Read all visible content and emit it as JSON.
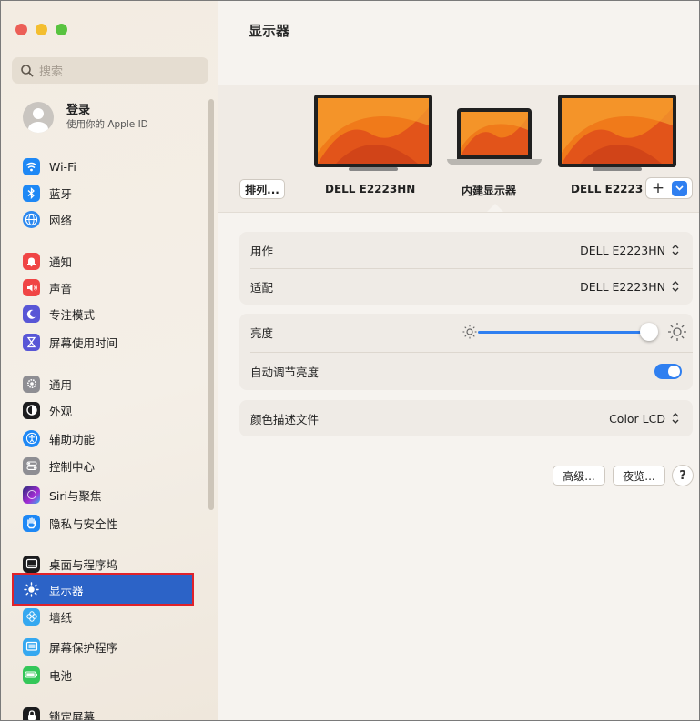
{
  "window": {
    "traffic_lights": {
      "close": "#ec5f57",
      "minimize": "#f3be2f",
      "zoom": "#58c33f"
    }
  },
  "sidebar": {
    "search": {
      "placeholder": "搜索",
      "icon": "search-icon"
    },
    "account": {
      "title": "登录",
      "subtitle": "使用你的 Apple ID"
    },
    "items": [
      {
        "label": "Wi-Fi",
        "icon": "wifi-icon",
        "color": "#1e88f5"
      },
      {
        "label": "蓝牙",
        "icon": "bluetooth-icon",
        "color": "#1e88f5"
      },
      {
        "label": "网络",
        "icon": "globe-icon",
        "color": "#2d89ef"
      },
      {
        "label": "通知",
        "icon": "bell-icon",
        "color": "#f04545"
      },
      {
        "label": "声音",
        "icon": "speaker-icon",
        "color": "#f04545"
      },
      {
        "label": "专注模式",
        "icon": "moon-icon",
        "color": "#5856d6"
      },
      {
        "label": "屏幕使用时间",
        "icon": "hourglass-icon",
        "color": "#5856d6"
      },
      {
        "label": "通用",
        "icon": "gear-icon",
        "color": "#8e8e93"
      },
      {
        "label": "外观",
        "icon": "appearance-icon",
        "color": "#1c1c1e"
      },
      {
        "label": "辅助功能",
        "icon": "accessibility-icon",
        "color": "#1e88f5"
      },
      {
        "label": "控制中心",
        "icon": "control-center-icon",
        "color": "#8e8e93"
      },
      {
        "label": "Siri与聚焦",
        "icon": "siri-icon",
        "color": "#6a3fd1"
      },
      {
        "label": "隐私与安全性",
        "icon": "hand-icon",
        "color": "#1e88f5"
      },
      {
        "label": "桌面与程序坞",
        "icon": "dock-icon",
        "color": "#1c1c1e"
      },
      {
        "label": "显示器",
        "icon": "sun-icon",
        "color": "#2c63c7",
        "selected": true
      },
      {
        "label": "墙纸",
        "icon": "wallpaper-icon",
        "color": "#35a8f0"
      },
      {
        "label": "屏幕保护程序",
        "icon": "screensaver-icon",
        "color": "#35a8f0"
      },
      {
        "label": "电池",
        "icon": "battery-icon",
        "color": "#34c759"
      },
      {
        "label": "锁定屏幕",
        "icon": "lock-icon",
        "color": "#1c1c1e"
      }
    ]
  },
  "main": {
    "title": "显示器",
    "arrange_button": "排列...",
    "displays": [
      {
        "label": "DELL E2223HN",
        "kind": "external-monitor"
      },
      {
        "label": "内建显示器",
        "kind": "laptop",
        "selected": true
      },
      {
        "label": "DELL E2223",
        "kind": "external-monitor"
      }
    ],
    "add_button": "+",
    "use_as": {
      "label": "用作",
      "value": "DELL E2223HN"
    },
    "optimize_for": {
      "label": "适配",
      "value": "DELL E2223HN"
    },
    "brightness": {
      "label": "亮度",
      "value_fraction": 0.95
    },
    "auto_brightness": {
      "label": "自动调节亮度",
      "enabled": true
    },
    "color_profile": {
      "label": "颜色描述文件",
      "value": "Color LCD"
    },
    "advanced_button": "高级...",
    "night_shift_button": "夜览...",
    "help_button": "?"
  }
}
